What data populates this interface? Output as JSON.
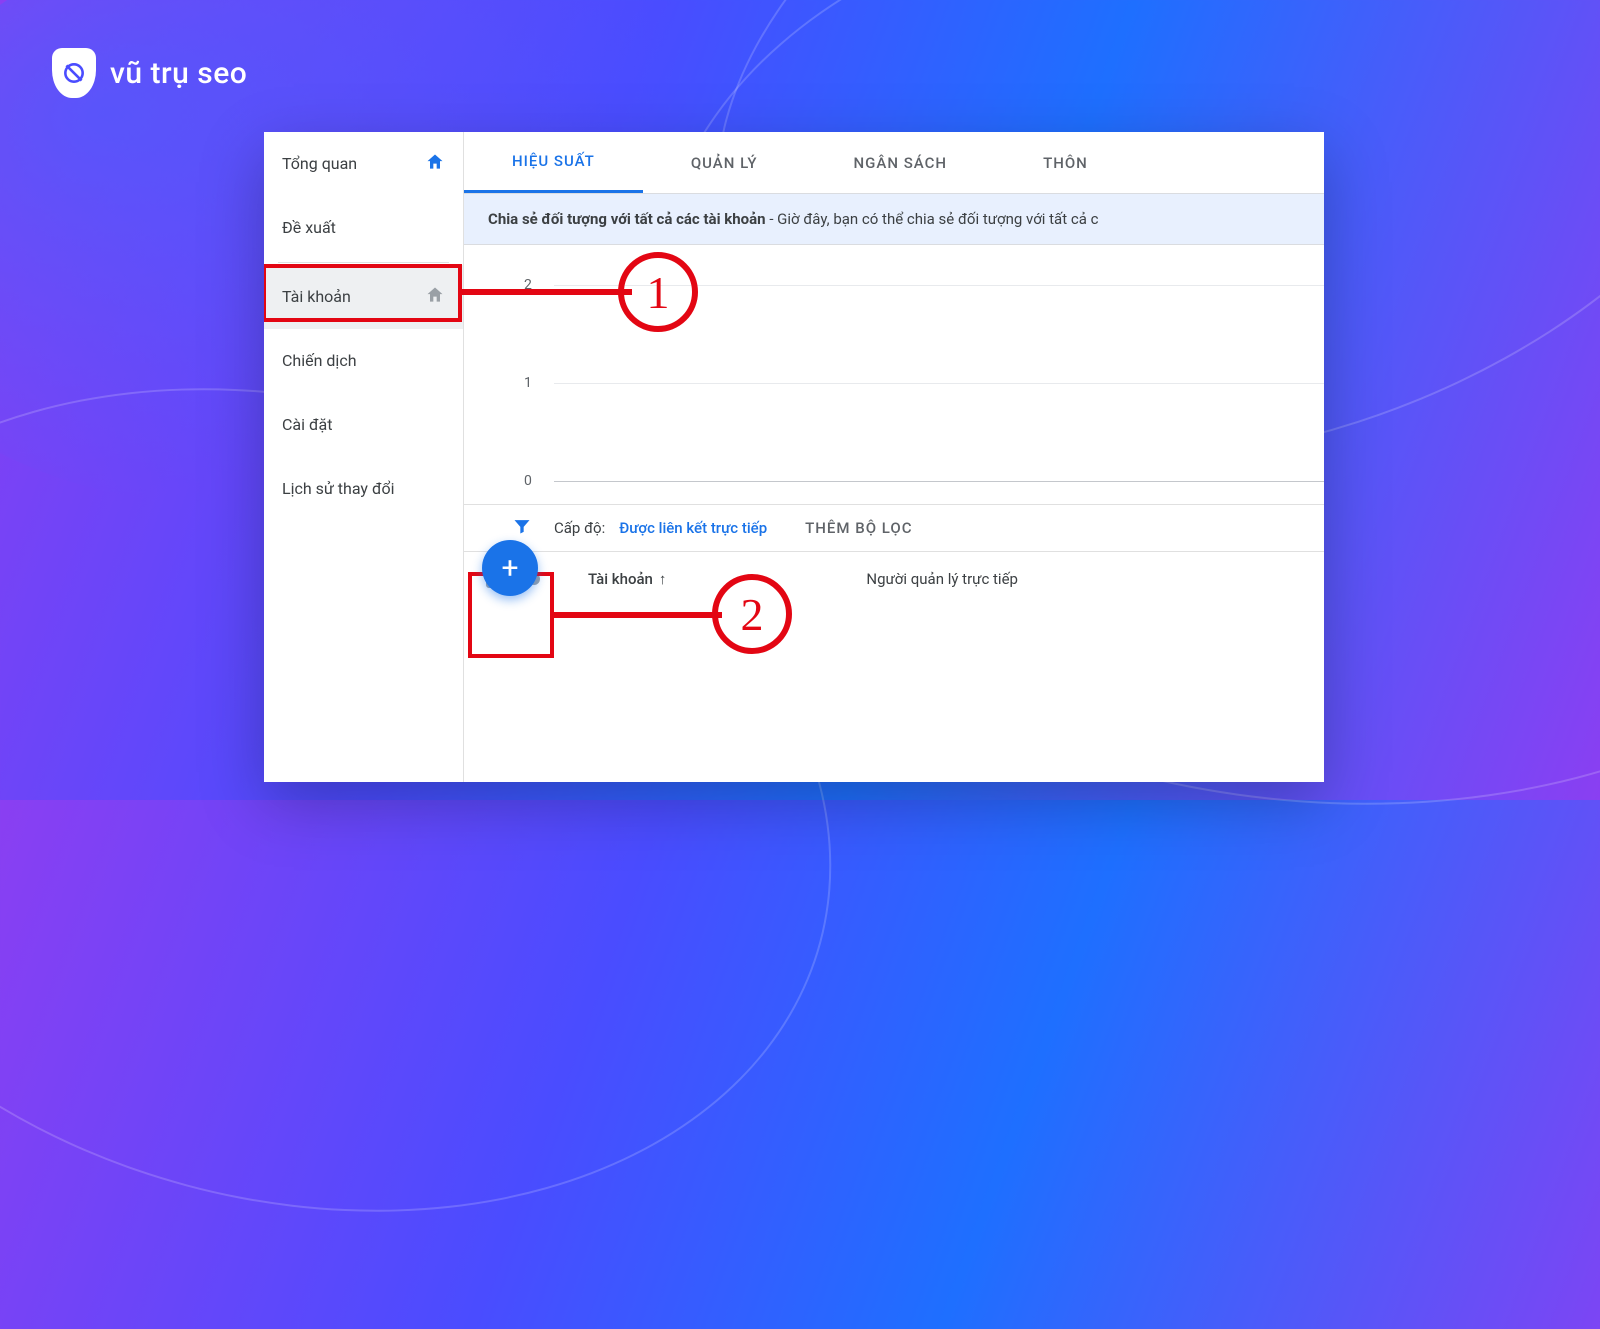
{
  "brand": {
    "name": "vũ trụ seo"
  },
  "sidebar": {
    "items": [
      {
        "label": "Tổng quan",
        "icon": "home",
        "active_icon": true
      },
      {
        "label": "Đề xuất"
      },
      {
        "label": "Tài khoản",
        "icon": "home",
        "selected": true
      },
      {
        "label": "Chiến dịch"
      },
      {
        "label": "Cài đặt"
      },
      {
        "label": "Lịch sử thay đổi"
      }
    ]
  },
  "tabs": [
    {
      "label": "HIỆU SUẤT",
      "active": true
    },
    {
      "label": "QUẢN LÝ"
    },
    {
      "label": "NGÂN SÁCH"
    },
    {
      "label": "THÔN"
    }
  ],
  "banner": {
    "bold": "Chia sẻ đối tượng với tất cả các tài khoản",
    "rest": " - Giờ đây, bạn có thể chia sẻ đối tượng với tất cả c"
  },
  "chart_data": {
    "type": "line",
    "title": "",
    "xlabel": "",
    "ylabel": "",
    "ylim": [
      0,
      2
    ],
    "yticks": [
      0,
      1,
      2
    ],
    "series": [],
    "categories": []
  },
  "filters": {
    "level_label": "Cấp độ:",
    "level_value": "Được liên kết trực tiếp",
    "add_filter": "THÊM BỘ LỌC"
  },
  "table": {
    "col_account": "Tài khoản",
    "sort_arrow": "↑",
    "col_manager": "Người quản lý trực tiếp"
  },
  "annotations": {
    "step1": "1",
    "step2": "2"
  },
  "colors": {
    "accent": "#1a73e8",
    "anno": "#e30613"
  }
}
